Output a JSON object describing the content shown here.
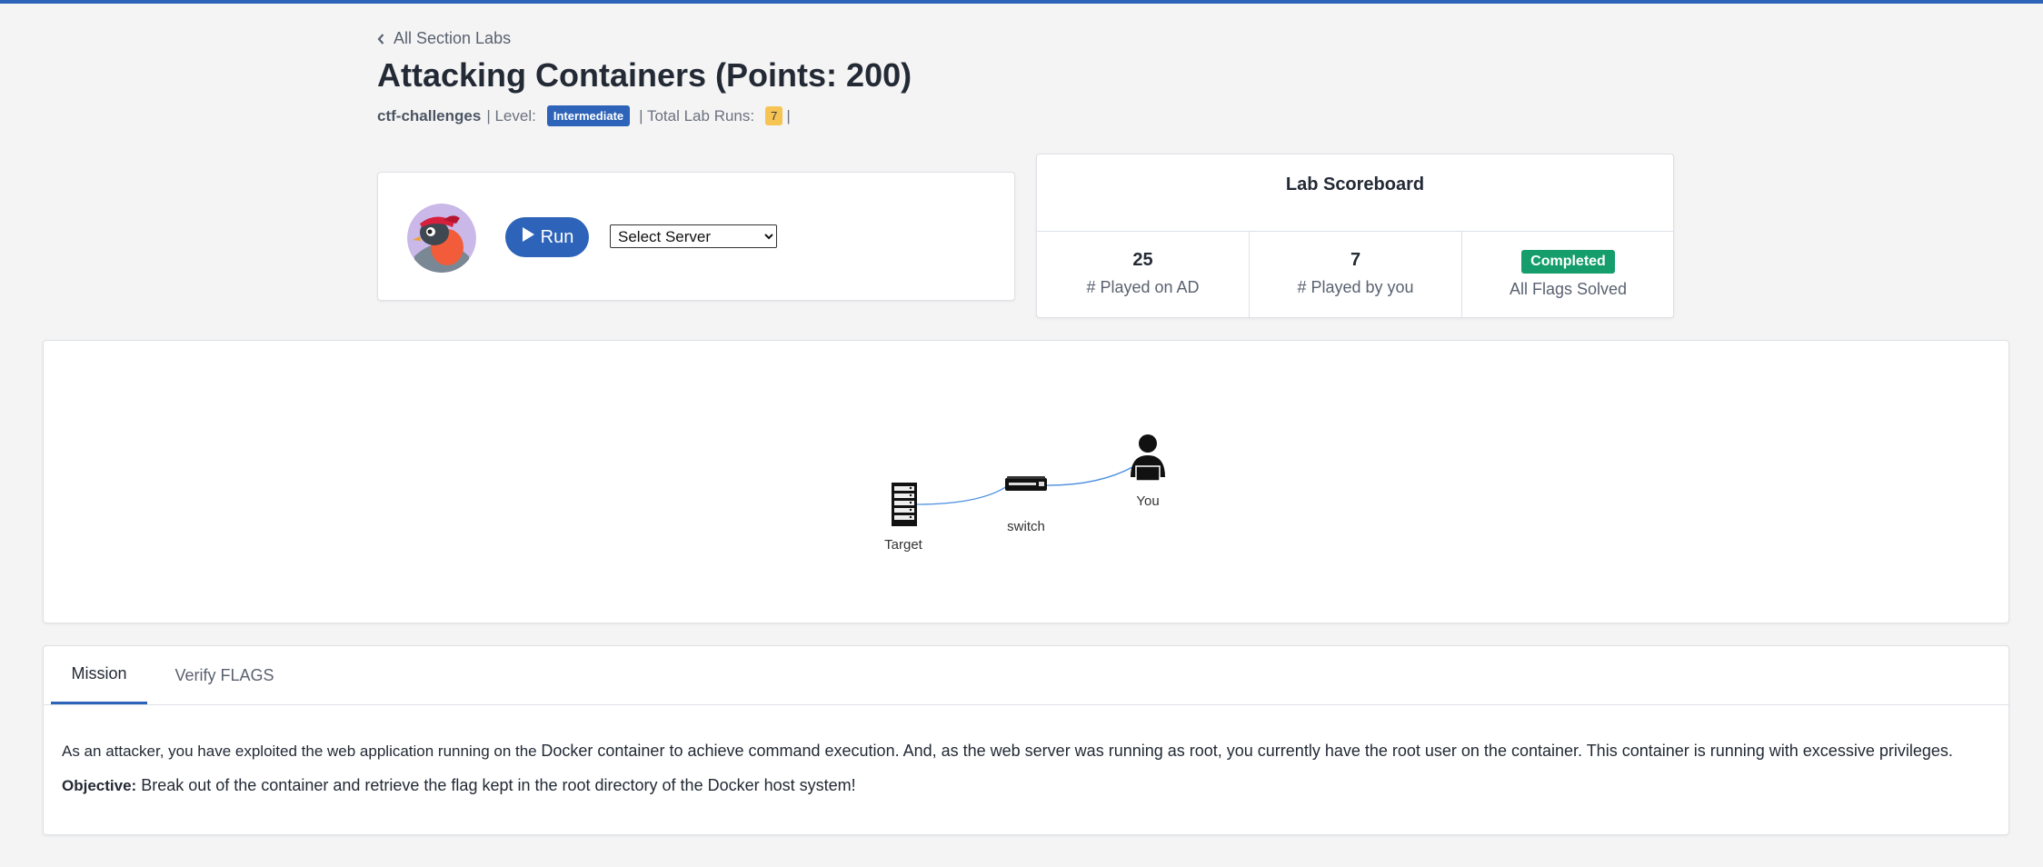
{
  "nav": {
    "back_label": "All Section Labs"
  },
  "lab": {
    "title": "Attacking Containers (Points: 200)",
    "category": "ctf-challenges",
    "level_prefix": "| Level:",
    "level": "Intermediate",
    "runs_prefix": "| Total Lab Runs:",
    "total_runs": "7",
    "trailing_sep": "|"
  },
  "run_panel": {
    "run_label": "Run",
    "server_select": {
      "selected": "Select Server"
    }
  },
  "scoreboard": {
    "title": "Lab Scoreboard",
    "played_on_ad": "25",
    "played_on_ad_label": "# Played on AD",
    "played_by_you": "7",
    "played_by_you_label": "# Played by you",
    "status": "Completed",
    "status_label": "All Flags Solved"
  },
  "topology": {
    "nodes": [
      {
        "label": "Target",
        "icon": "server-rack-icon"
      },
      {
        "label": "switch",
        "icon": "network-switch-icon"
      },
      {
        "label": "You",
        "icon": "hacker-user-icon"
      }
    ]
  },
  "tabs": {
    "mission": "Mission",
    "verify": "Verify FLAGS"
  },
  "mission": {
    "text_part1": "As an attacker, you have exploited the web application running on the",
    "text_highlight": "Docker container to achieve command execution. And, as the web server was running as root, you currently have the root user on the container. This container is running with excessive privileges.",
    "objective_label": "Objective:",
    "objective_text": "Break out of the container and retrieve the flag kept in the root directory of the Docker host system!"
  },
  "colors": {
    "primary": "#2d63b8",
    "success": "#159e6b",
    "warning": "#f6c453",
    "link_line": "#4a8de0"
  }
}
